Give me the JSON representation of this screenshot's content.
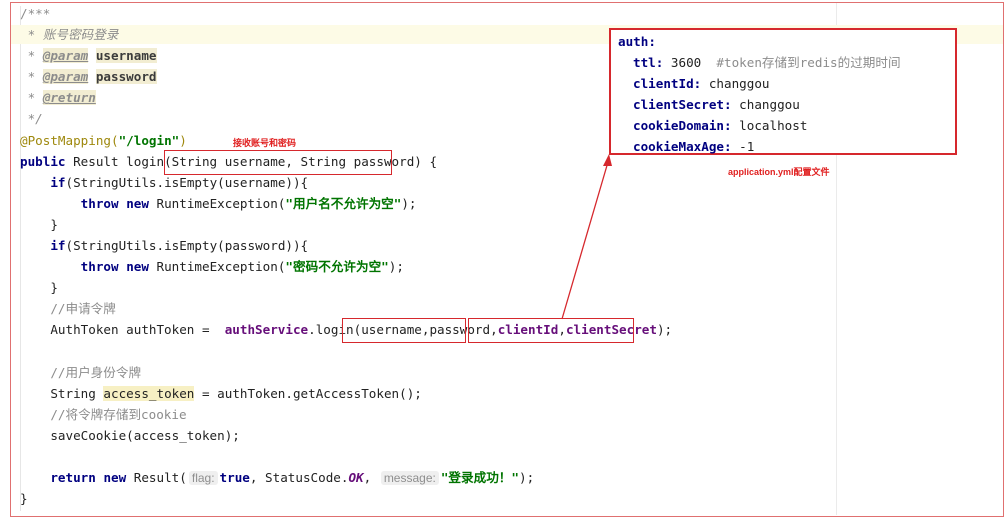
{
  "code": {
    "lines": [
      [
        {
          "t": "/***",
          "c": "c"
        }
      ],
      [
        {
          "t": " * ",
          "c": "doc"
        },
        {
          "t": "账号密码登录",
          "c": "doc"
        }
      ],
      [
        {
          "t": " * ",
          "c": "doc"
        },
        {
          "t": "@param",
          "c": "tag"
        },
        {
          "t": " ",
          "c": "doc"
        },
        {
          "t": "username",
          "c": "pn"
        }
      ],
      [
        {
          "t": " * ",
          "c": "doc"
        },
        {
          "t": "@param",
          "c": "tag"
        },
        {
          "t": " ",
          "c": "doc"
        },
        {
          "t": "password",
          "c": "pn"
        }
      ],
      [
        {
          "t": " * ",
          "c": "doc"
        },
        {
          "t": "@return",
          "c": "tag"
        }
      ],
      [
        {
          "t": " */",
          "c": "doc"
        }
      ],
      [
        {
          "t": "@PostMapping(",
          "c": "ann"
        },
        {
          "t": "\"/login\"",
          "c": "str"
        },
        {
          "t": ")",
          "c": "ann"
        }
      ],
      [
        {
          "t": "public",
          "c": "kw"
        },
        {
          "t": " Result login(String username, String password) {",
          "c": ""
        }
      ],
      [
        {
          "t": "    ",
          "c": ""
        },
        {
          "t": "if",
          "c": "kw"
        },
        {
          "t": "(StringUtils.isEmpty(username)){",
          "c": ""
        }
      ],
      [
        {
          "t": "        ",
          "c": ""
        },
        {
          "t": "throw",
          "c": "kw"
        },
        {
          "t": " ",
          "c": ""
        },
        {
          "t": "new",
          "c": "kw"
        },
        {
          "t": " RuntimeException(",
          "c": ""
        },
        {
          "t": "\"用户名不允许为空\"",
          "c": "str"
        },
        {
          "t": ");",
          "c": ""
        }
      ],
      [
        {
          "t": "    }",
          "c": ""
        }
      ],
      [
        {
          "t": "    ",
          "c": ""
        },
        {
          "t": "if",
          "c": "kw"
        },
        {
          "t": "(StringUtils.isEmpty(password)){",
          "c": ""
        }
      ],
      [
        {
          "t": "        ",
          "c": ""
        },
        {
          "t": "throw",
          "c": "kw"
        },
        {
          "t": " ",
          "c": ""
        },
        {
          "t": "new",
          "c": "kw"
        },
        {
          "t": " RuntimeException(",
          "c": ""
        },
        {
          "t": "\"密码不允许为空\"",
          "c": "str"
        },
        {
          "t": ");",
          "c": ""
        }
      ],
      [
        {
          "t": "    }",
          "c": ""
        }
      ],
      [
        {
          "t": "    //申请令牌",
          "c": "c"
        }
      ],
      [
        {
          "t": "    AuthToken authToken =  ",
          "c": ""
        },
        {
          "t": "authService",
          "c": "fld"
        },
        {
          "t": ".login(username,password,",
          "c": ""
        },
        {
          "t": "clientId",
          "c": "fld"
        },
        {
          "t": ",",
          "c": ""
        },
        {
          "t": "clientSecret",
          "c": "fld"
        },
        {
          "t": ");",
          "c": ""
        }
      ],
      [
        {
          "t": "",
          "c": ""
        }
      ],
      [
        {
          "t": "    //用户身份令牌",
          "c": "c"
        }
      ],
      [
        {
          "t": "    String ",
          "c": ""
        },
        {
          "t": "access_token",
          "c": "hlv"
        },
        {
          "t": " = authToken.getAccessToken();",
          "c": ""
        }
      ],
      [
        {
          "t": "    //将令牌存储到cookie",
          "c": "c"
        }
      ],
      [
        {
          "t": "    saveCookie(access_token);",
          "c": ""
        }
      ],
      [
        {
          "t": "",
          "c": ""
        }
      ],
      [
        {
          "t": "    ",
          "c": ""
        },
        {
          "t": "return",
          "c": "kw"
        },
        {
          "t": " ",
          "c": ""
        },
        {
          "t": "new",
          "c": "kw"
        },
        {
          "t": " Result(",
          "c": ""
        },
        {
          "t": "flag:",
          "c": "hint"
        },
        {
          "t": "true",
          "c": "kw"
        },
        {
          "t": ", StatusCode.",
          "c": ""
        },
        {
          "t": "OK",
          "c": "cst"
        },
        {
          "t": ", ",
          "c": ""
        },
        {
          "t": "message:",
          "c": "hint"
        },
        {
          "t": "\"登录成功！\"",
          "c": "str"
        },
        {
          "t": ");",
          "c": ""
        }
      ],
      [
        {
          "t": "}",
          "c": ""
        }
      ]
    ]
  },
  "notes": {
    "params_note": "接收账号和密码",
    "yml_note": "application.yml配置文件"
  },
  "yml": {
    "root": "auth:",
    "entries": [
      {
        "key": "ttl:",
        "value": " 3600  ",
        "comment": "#token存储到redis的过期时间"
      },
      {
        "key": "clientId:",
        "value": " changgou",
        "comment": ""
      },
      {
        "key": "clientSecret:",
        "value": " changgou",
        "comment": ""
      },
      {
        "key": "cookieDomain:",
        "value": " localhost",
        "comment": ""
      },
      {
        "key": "cookieMaxAge:",
        "value": " -1",
        "comment": ""
      }
    ]
  },
  "colors": {
    "annotation_red": "#d6282d",
    "keyword": "#000080",
    "string": "#007400",
    "field": "#660e7a",
    "comment": "#8c8c8c"
  }
}
